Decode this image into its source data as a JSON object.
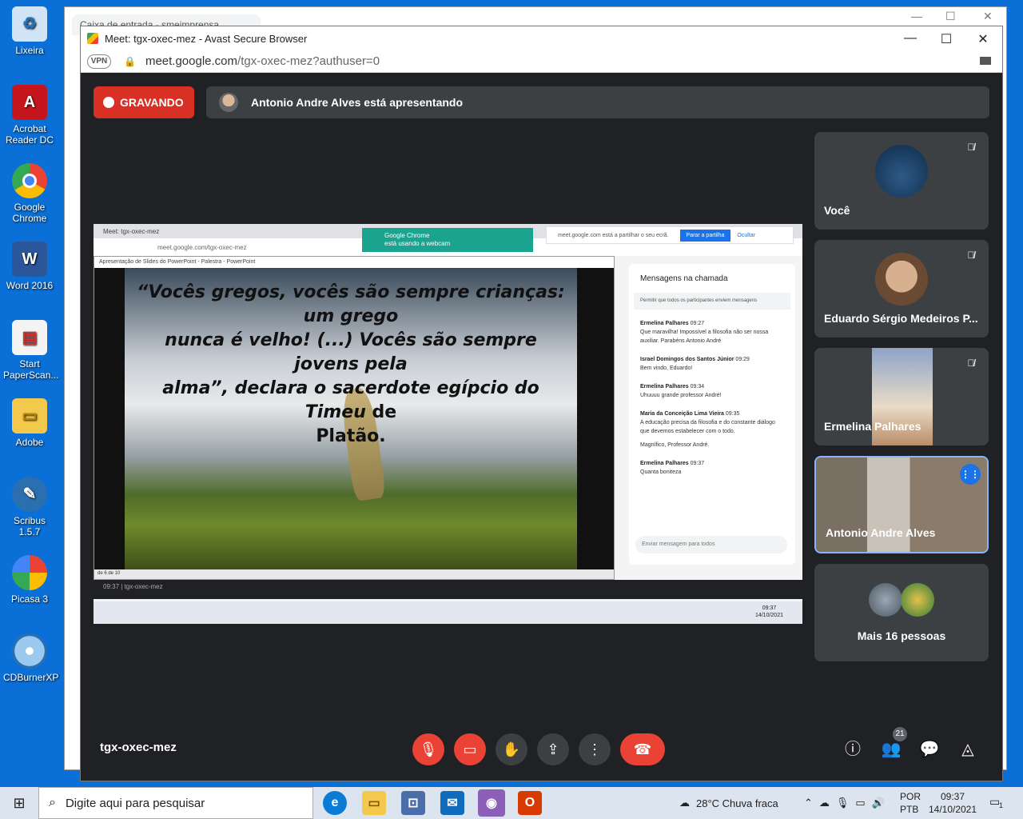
{
  "desktop": {
    "icons": [
      {
        "label": "Lixeira",
        "icon": "recycle-bin-icon"
      },
      {
        "label": "Acrobat Reader DC",
        "icon": "acrobat-icon"
      },
      {
        "label": "Google Chrome",
        "icon": "chrome-icon"
      },
      {
        "label": "Word 2016",
        "icon": "word-icon"
      },
      {
        "label": "Start PaperScan...",
        "icon": "paperscan-icon"
      },
      {
        "label": "Adobe",
        "icon": "folder-icon"
      },
      {
        "label": "Scribus 1.5.7",
        "icon": "scribus-icon"
      },
      {
        "label": "Picasa 3",
        "icon": "picasa-icon"
      },
      {
        "label": "CDBurnerXP",
        "icon": "cdburner-icon"
      }
    ]
  },
  "bg_window": {
    "tab_title": "Caixa de entrada - smeimprensa..."
  },
  "meet_window": {
    "title": "Meet: tgx-oxec-mez - Avast Secure Browser",
    "vpn": "VPN",
    "url_host": "meet.google.com",
    "url_path": "/tgx-oxec-mez?authuser=0"
  },
  "meet": {
    "recording_label": "GRAVANDO",
    "presenting_text": "Antonio Andre Alves está apresentando",
    "meeting_code": "tgx-oxec-mez",
    "people_count": "21",
    "participants": [
      {
        "name": "Você",
        "muted": true
      },
      {
        "name": "Eduardo Sérgio Medeiros P...",
        "muted": true
      },
      {
        "name": "Ermelina Palhares",
        "muted": true
      },
      {
        "name": "Antonio Andre Alves",
        "speaking": true
      }
    ],
    "more_label": "Mais 16 pessoas"
  },
  "shared_screen": {
    "tab_title": "Meet: tgx-oxec-mez",
    "url": "meet.google.com/tgx-oxec-mez",
    "ppt_title": "Apresentação de Slides do PowerPoint - Palestra - PowerPoint",
    "quote_line1": "“Vocês gregos, vocês são sempre crianças: um grego",
    "quote_line2": "nunca é velho! (...) Vocês são sempre jovens pela",
    "quote_line3": "alma”, declara o sacerdote egípcio do Timeu",
    "quote_de": "de",
    "quote_line4": "Platão.",
    "slide_counter": "de 6 de 10",
    "chrome_note_title": "Google Chrome",
    "chrome_note_sub": "está usando a webcam",
    "sharing_text": "meet.google.com está a partilhar o seu ecrã.",
    "sharing_button": "Parar a partilha",
    "sharing_hide": "Ocultar",
    "bottom_time": "09:37",
    "bottom_code": "tgx-oxec-mez",
    "taskbar_time": "09:37",
    "taskbar_date": "14/10/2021",
    "chat": {
      "title": "Mensagens na chamada",
      "permission": "Permitir que todos os participantes enviem mensagens",
      "messages": [
        {
          "author": "Ermelina Palhares",
          "time": "09:27",
          "text": "Que maravilha! Impossível a filosofia não ser nossa auxiliar. Parabéns Antonio André"
        },
        {
          "author": "Israel Domingos dos Santos Júnior",
          "time": "09:29",
          "text": "Bem vindo, Eduardo!"
        },
        {
          "author": "Ermelina Palhares",
          "time": "09:34",
          "text": "Uhuuuu grande professor André!"
        },
        {
          "author": "Maria da Conceição Lima Vieira",
          "time": "09:35",
          "text": "A educação precisa da filosofia e do constante diálogo que devemos estabelecer com o todo."
        },
        {
          "author": "",
          "time": "",
          "text": "Magnífico, Professor André."
        },
        {
          "author": "Ermelina Palhares",
          "time": "09:37",
          "text": "Quanta boniteza"
        }
      ],
      "input_placeholder": "Enviar mensagem para todos"
    }
  },
  "taskbar": {
    "search_placeholder": "Digite aqui para pesquisar",
    "weather": "28°C  Chuva fraca",
    "lang_top": "POR",
    "lang_bottom": "PTB",
    "time": "09:37",
    "date": "14/10/2021",
    "notifications": "1"
  }
}
